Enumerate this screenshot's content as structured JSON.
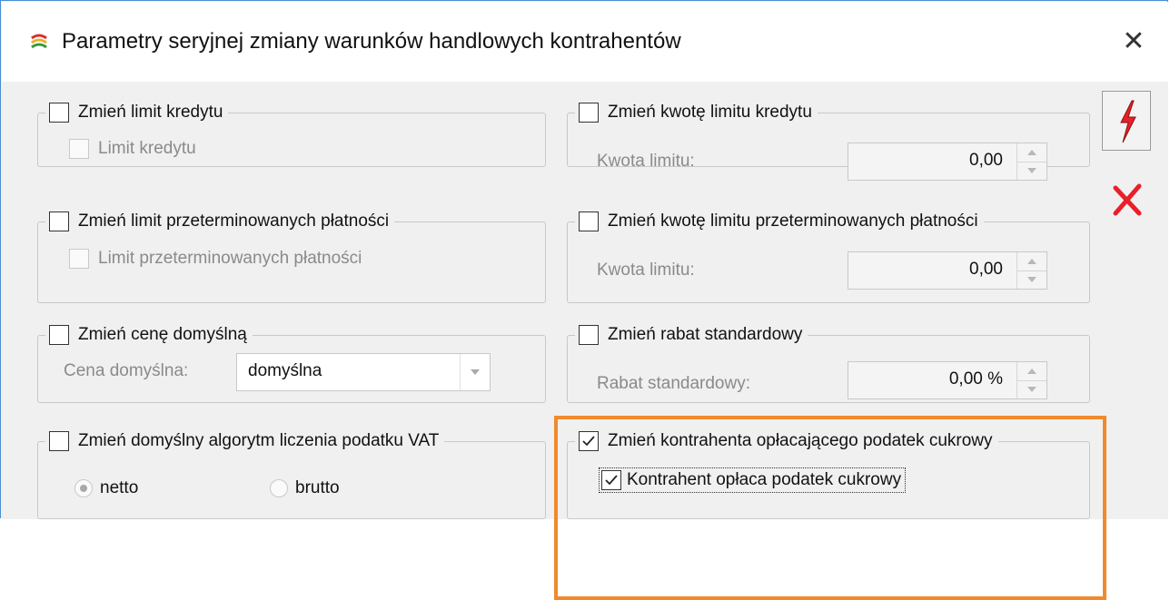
{
  "window": {
    "title": "Parametry seryjnej zmiany warunków handlowych kontrahentów"
  },
  "groups": {
    "limit_kredytu": {
      "legend": "Zmień limit kredytu",
      "checked": false,
      "sub_checkbox": "Limit kredytu"
    },
    "kwota_limitu_kredytu": {
      "legend": "Zmień kwotę limitu kredytu",
      "checked": false,
      "field_label": "Kwota limitu:",
      "value": "0,00"
    },
    "limit_przeterminowanych": {
      "legend": "Zmień limit przeterminowanych płatności",
      "checked": false,
      "sub_checkbox": "Limit przeterminowanych płatności"
    },
    "kwota_limitu_przeterminowanych": {
      "legend": "Zmień kwotę limitu przeterminowanych płatności",
      "checked": false,
      "field_label": "Kwota limitu:",
      "value": "0,00"
    },
    "cena_domyslna": {
      "legend": "Zmień cenę domyślną",
      "checked": false,
      "field_label": "Cena domyślna:",
      "value": "domyślna"
    },
    "rabat_standardowy": {
      "legend": "Zmień rabat standardowy",
      "checked": false,
      "field_label": "Rabat standardowy:",
      "value": "0,00 %"
    },
    "algorytm_vat": {
      "legend": "Zmień domyślny algorytm liczenia podatku VAT",
      "checked": false,
      "options": [
        "netto",
        "brutto"
      ],
      "selected": "netto"
    },
    "podatek_cukrowy": {
      "legend": "Zmień kontrahenta opłacającego podatek cukrowy",
      "checked": true,
      "sub_checkbox": "Kontrahent opłaca podatek cukrowy",
      "sub_checked": true
    }
  },
  "colors": {
    "highlight": "#f08a2c",
    "lightning": "#e8202a",
    "cancel": "#e8202a",
    "window_border": "#4a8fd4"
  },
  "icons": {
    "app": "app-icon",
    "close": "close-icon",
    "run": "lightning-icon",
    "cancel": "cancel-x-icon"
  }
}
